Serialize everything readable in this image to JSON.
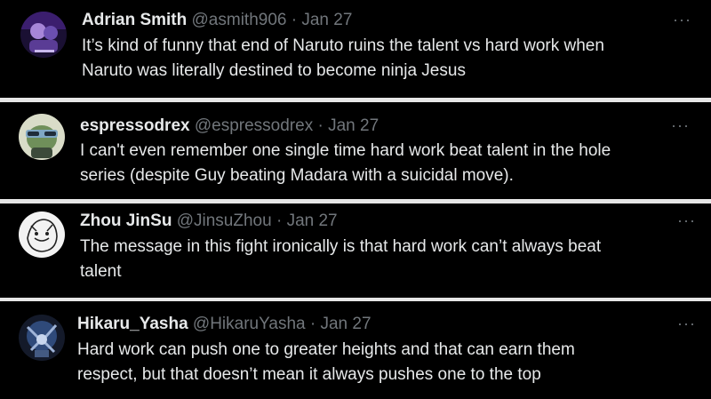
{
  "tweets": [
    {
      "name": "Adrian Smith",
      "handle": "@asmith906",
      "separator": "·",
      "date": "Jan 27",
      "lines": [
        "It’s kind of funny that end of Naruto ruins the talent vs hard work when",
        "Naruto was literally destined to become ninja Jesus"
      ],
      "more_icon": "more-horizontal-icon",
      "more_glyph": "···"
    },
    {
      "name": "espressodrex",
      "handle": "@espressodrex",
      "separator": "·",
      "date": "Jan 27",
      "lines": [
        "I can't even remember one single time hard work beat talent in the hole",
        "series (despite Guy beating Madara with a suicidal move)."
      ],
      "more_icon": "more-horizontal-icon",
      "more_glyph": "···"
    },
    {
      "name": "Zhou JinSu",
      "handle": "@JinsuZhou",
      "separator": "·",
      "date": "Jan 27",
      "lines": [
        "The message in this fight ironically is that hard work can’t always beat",
        "talent"
      ],
      "more_icon": "more-horizontal-icon",
      "more_glyph": "···"
    },
    {
      "name": "Hikaru_Yasha",
      "handle": "@HikaruYasha",
      "separator": "·",
      "date": "Jan 27",
      "lines": [
        "Hard work can push one to greater heights and that can earn them",
        "respect, but that doesn’t mean it always pushes one to the top"
      ],
      "more_icon": "more-horizontal-icon",
      "more_glyph": "···"
    }
  ],
  "colors": {
    "background": "#000000",
    "text": "#e7e9ea",
    "secondary_text": "#71767b",
    "separator": "#e6e6e6"
  }
}
